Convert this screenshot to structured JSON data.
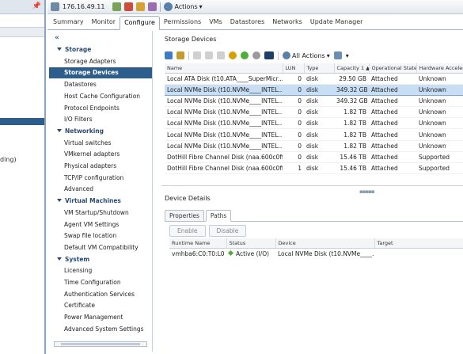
{
  "left_panel": {
    "truncated_text": "ding)"
  },
  "titlebar": {
    "host": "176.16.49.11",
    "actions_label": "Actions"
  },
  "tabs": [
    "Summary",
    "Monitor",
    "Configure",
    "Permissions",
    "VMs",
    "Datastores",
    "Networks",
    "Update Manager"
  ],
  "nav": {
    "collapse": "«",
    "items": [
      {
        "label": "Storage",
        "type": "section"
      },
      {
        "label": "Storage Adapters",
        "type": "item"
      },
      {
        "label": "Storage Devices",
        "type": "selected"
      },
      {
        "label": "Datastores",
        "type": "item"
      },
      {
        "label": "Host Cache Configuration",
        "type": "item"
      },
      {
        "label": "Protocol Endpoints",
        "type": "item"
      },
      {
        "label": "I/O Filters",
        "type": "item"
      },
      {
        "label": "Networking",
        "type": "section"
      },
      {
        "label": "Virtual switches",
        "type": "item"
      },
      {
        "label": "VMkernel adapters",
        "type": "item"
      },
      {
        "label": "Physical adapters",
        "type": "item"
      },
      {
        "label": "TCP/IP configuration",
        "type": "item"
      },
      {
        "label": "Advanced",
        "type": "item"
      },
      {
        "label": "Virtual Machines",
        "type": "section"
      },
      {
        "label": "VM Startup/Shutdown",
        "type": "item"
      },
      {
        "label": "Agent VM Settings",
        "type": "item"
      },
      {
        "label": "Swap file location",
        "type": "item"
      },
      {
        "label": "Default VM Compatibility",
        "type": "item"
      },
      {
        "label": "System",
        "type": "section"
      },
      {
        "label": "Licensing",
        "type": "item"
      },
      {
        "label": "Time Configuration",
        "type": "item"
      },
      {
        "label": "Authentication Services",
        "type": "item"
      },
      {
        "label": "Certificate",
        "type": "item"
      },
      {
        "label": "Power Management",
        "type": "item"
      },
      {
        "label": "Advanced System Settings",
        "type": "item"
      }
    ]
  },
  "storage_devices": {
    "title": "Storage Devices",
    "all_actions": "All Actions",
    "columns": [
      "Name",
      "LUN",
      "Type",
      "Capacity",
      "Operational State",
      "Hardware Acceleration"
    ],
    "sort_indicator": "1 ▲",
    "rows": [
      {
        "name": "Local ATA Disk (t10.ATA____SuperMicr...",
        "lun": "0",
        "type": "disk",
        "capacity": "29.50 GB",
        "state": "Attached",
        "hwaccel": "Unknown",
        "selected": false
      },
      {
        "name": "Local NVMe Disk (t10.NVMe____INTEL...",
        "lun": "0",
        "type": "disk",
        "capacity": "349.32 GB",
        "state": "Attached",
        "hwaccel": "Unknown",
        "selected": true
      },
      {
        "name": "Local NVMe Disk (t10.NVMe____INTEL...",
        "lun": "0",
        "type": "disk",
        "capacity": "349.32 GB",
        "state": "Attached",
        "hwaccel": "Unknown",
        "selected": false
      },
      {
        "name": "Local NVMe Disk (t10.NVMe____INTEL...",
        "lun": "0",
        "type": "disk",
        "capacity": "1.82 TB",
        "state": "Attached",
        "hwaccel": "Unknown",
        "selected": false
      },
      {
        "name": "Local NVMe Disk (t10.NVMe____INTEL...",
        "lun": "0",
        "type": "disk",
        "capacity": "1.82 TB",
        "state": "Attached",
        "hwaccel": "Unknown",
        "selected": false
      },
      {
        "name": "Local NVMe Disk (t10.NVMe____INTEL...",
        "lun": "0",
        "type": "disk",
        "capacity": "1.82 TB",
        "state": "Attached",
        "hwaccel": "Unknown",
        "selected": false
      },
      {
        "name": "Local NVMe Disk (t10.NVMe____INTEL...",
        "lun": "0",
        "type": "disk",
        "capacity": "1.82 TB",
        "state": "Attached",
        "hwaccel": "Unknown",
        "selected": false
      },
      {
        "name": "DotHill Fibre Channel Disk (naa.600c0ff0...",
        "lun": "0",
        "type": "disk",
        "capacity": "15.46 TB",
        "state": "Attached",
        "hwaccel": "Supported",
        "selected": false
      },
      {
        "name": "DotHill Fibre Channel Disk (naa.600c0ff0...",
        "lun": "1",
        "type": "disk",
        "capacity": "15.46 TB",
        "state": "Attached",
        "hwaccel": "Supported",
        "selected": false
      }
    ]
  },
  "device_details": {
    "title": "Device Details",
    "tabs": [
      "Properties",
      "Paths"
    ],
    "buttons": {
      "enable": "Enable",
      "disable": "Disable"
    },
    "path_columns": [
      "Runtime Name",
      "Status",
      "Device",
      "Target"
    ],
    "paths": [
      {
        "runtime": "vmhba6:C0:T0:L0",
        "status": "Active (I/O)",
        "device": "Local NVMe Disk (t10.NVMe____...",
        "target": ""
      }
    ]
  },
  "colors": {
    "accent": "#2d5d8d",
    "selected_row": "#c7def5",
    "status_green": "#5aa83a"
  }
}
